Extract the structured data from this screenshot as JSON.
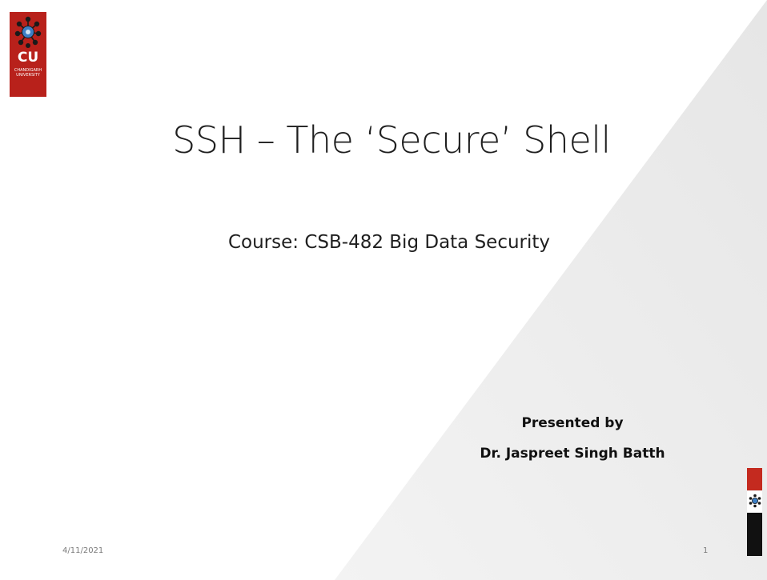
{
  "slide": {
    "title": "SSH – The ‘Secure’ Shell",
    "subtitle": "Course: CSB-482 Big Data Security",
    "presented_by": "Presented by",
    "presenter_name": "Dr. Jaspreet Singh Batth",
    "date": "4/11/2021",
    "page_number": "1"
  },
  "logo": {
    "initials": "CU",
    "name_line1": "CHANDIGARH",
    "name_line2": "UNIVERSITY",
    "emblem_icon": "gear-emblem-icon"
  },
  "colors": {
    "logo_red": "#b8211b",
    "side_red": "#c42a1f",
    "side_black": "#111111",
    "triangle_gray": "#ededed",
    "text": "#1f1f1f"
  }
}
